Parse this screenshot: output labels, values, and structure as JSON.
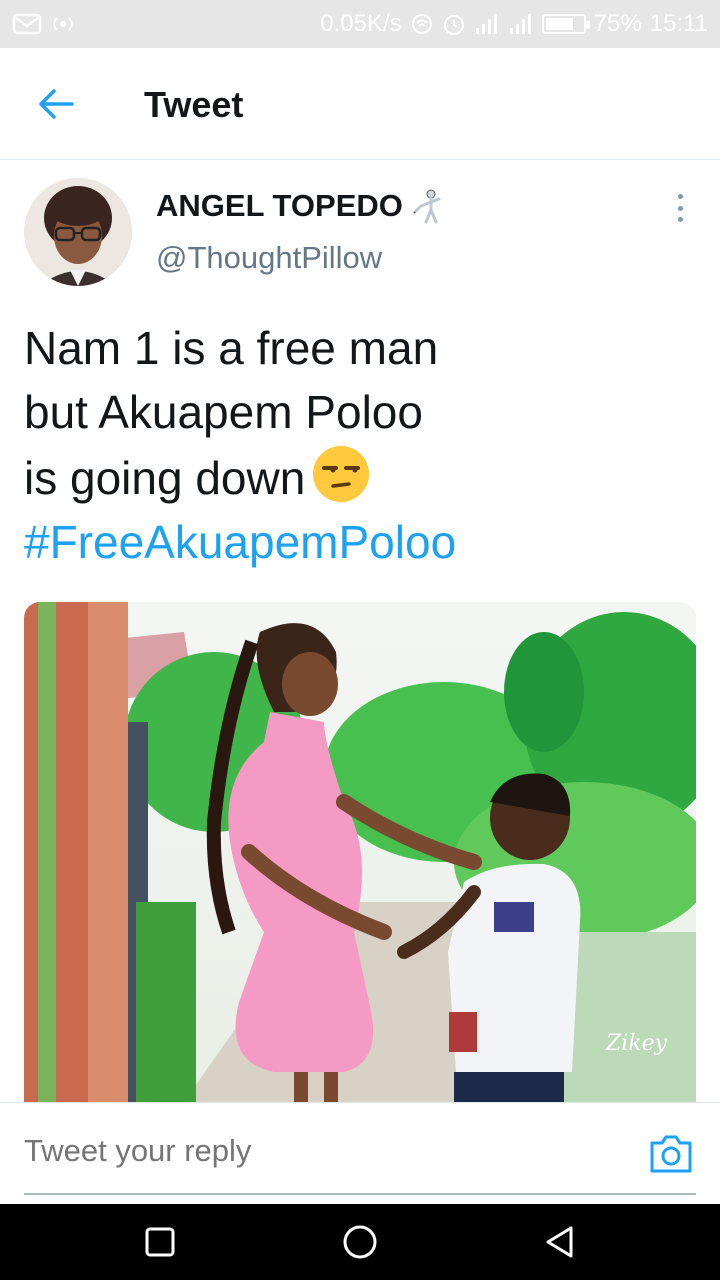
{
  "status_bar": {
    "network_speed": "0.05K/s",
    "battery_percent": "75%",
    "battery_level": 0.75,
    "time": "15:11",
    "icons": [
      "mail-icon",
      "hotspot-icon",
      "wifi-icon",
      "alarm-icon",
      "signal-icon",
      "signal-icon",
      "battery-icon"
    ]
  },
  "header": {
    "title": "Tweet",
    "back_icon": "arrow-left-icon"
  },
  "tweet": {
    "author_name": "ANGEL TOPEDO",
    "author_emoji": "fencer-icon",
    "handle": "@ThoughtPillow",
    "text_lines": [
      "Nam 1 is a free man",
      "but Akuapem Poloo",
      "is going down"
    ],
    "emoji": "unamused-face-icon",
    "hashtag": "#FreeAkuapemPoloo",
    "photo_watermark": "Zikey"
  },
  "reply": {
    "placeholder": "Tweet your reply",
    "camera_icon": "camera-icon"
  },
  "nav": {
    "icons": [
      "recents-icon",
      "home-icon",
      "back-icon"
    ]
  },
  "colors": {
    "accent": "#1da1f2",
    "secondary_text": "#657786",
    "status_bar_bg": "#e6e6e6",
    "nav_bar_bg": "#000000"
  }
}
